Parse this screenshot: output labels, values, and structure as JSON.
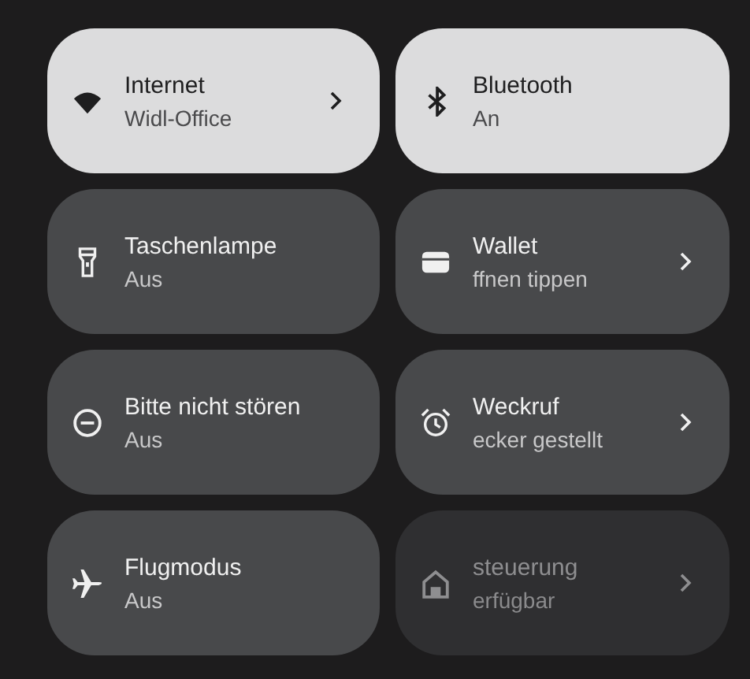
{
  "tiles": [
    {
      "title": "Internet",
      "subtitle": "Widl-Office",
      "on": true,
      "disabled": false,
      "chevron": true
    },
    {
      "title": "Bluetooth",
      "subtitle": "An",
      "on": true,
      "disabled": false,
      "chevron": false
    },
    {
      "title": "Taschenlampe",
      "subtitle": "Aus",
      "on": false,
      "disabled": false,
      "chevron": false
    },
    {
      "title": "Wallet",
      "subtitle": "ffnen tippen",
      "on": false,
      "disabled": false,
      "chevron": true
    },
    {
      "title": "Bitte nicht stören",
      "subtitle": "Aus",
      "on": false,
      "disabled": false,
      "chevron": false
    },
    {
      "title": "Weckruf",
      "subtitle": "ecker gestellt",
      "on": false,
      "disabled": false,
      "chevron": true
    },
    {
      "title": "Flugmodus",
      "subtitle": "Aus",
      "on": false,
      "disabled": false,
      "chevron": false
    },
    {
      "title": "steuerung",
      "subtitle": "erfügbar",
      "on": false,
      "disabled": true,
      "chevron": true
    }
  ]
}
